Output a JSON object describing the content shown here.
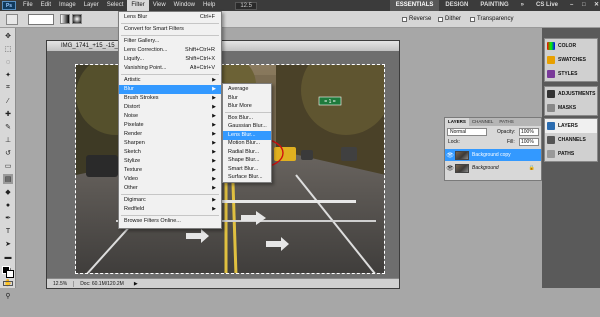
{
  "appbar": {
    "logo": "Ps",
    "menus": [
      "File",
      "Edit",
      "Image",
      "Layer",
      "Select",
      "Filter",
      "View",
      "Window",
      "Help"
    ],
    "active_menu": "Filter",
    "zoom": "12.5",
    "workspaces": [
      "ESSENTIALS",
      "DESIGN",
      "PAINTING"
    ],
    "more": "»",
    "cslive": "CS Live",
    "window_buttons": [
      "–",
      "□",
      "✕"
    ]
  },
  "options": {
    "reverse": "Reverse",
    "dither": "Dither",
    "transparency": "Transparency"
  },
  "document": {
    "title": "IMG_1741_+15_-15_Ima",
    "zoom": "12.5%",
    "doc_size": "Doc: 60.1M/120.2M"
  },
  "filter_menu": {
    "items": [
      {
        "label": "Lens Blur",
        "shortcut": "Ctrl+F"
      },
      {
        "label": "Convert for Smart Filters"
      },
      {
        "label": "Filter Gallery..."
      },
      {
        "label": "Lens Correction...",
        "shortcut": "Shift+Ctrl+R"
      },
      {
        "label": "Liquify...",
        "shortcut": "Shift+Ctrl+X"
      },
      {
        "label": "Vanishing Point...",
        "shortcut": "Alt+Ctrl+V"
      },
      {
        "label": "Artistic",
        "sub": true
      },
      {
        "label": "Blur",
        "sub": true,
        "highlight": true
      },
      {
        "label": "Brush Strokes",
        "sub": true
      },
      {
        "label": "Distort",
        "sub": true
      },
      {
        "label": "Noise",
        "sub": true
      },
      {
        "label": "Pixelate",
        "sub": true
      },
      {
        "label": "Render",
        "sub": true
      },
      {
        "label": "Sharpen",
        "sub": true
      },
      {
        "label": "Sketch",
        "sub": true
      },
      {
        "label": "Stylize",
        "sub": true
      },
      {
        "label": "Texture",
        "sub": true
      },
      {
        "label": "Video",
        "sub": true
      },
      {
        "label": "Other",
        "sub": true
      },
      {
        "label": "Digimarc",
        "sub": true
      },
      {
        "label": "Redfield",
        "sub": true
      },
      {
        "label": "Browse Filters Online..."
      }
    ]
  },
  "blur_menu": {
    "items": [
      "Average",
      "Blur",
      "Blur More",
      "Box Blur...",
      "Gaussian Blur...",
      "Lens Blur...",
      "Motion Blur...",
      "Radial Blur...",
      "Shape Blur...",
      "Smart Blur...",
      "Surface Blur..."
    ],
    "highlighted": "Lens Blur..."
  },
  "dock": {
    "group1": [
      "COLOR",
      "SWATCHES",
      "STYLES"
    ],
    "group2": [
      "ADJUSTMENTS",
      "MASKS"
    ],
    "group3": [
      "LAYERS",
      "CHANNELS",
      "PATHS"
    ]
  },
  "layers_panel": {
    "tabs": [
      "LAYERS",
      "CHANNEL",
      "PATHS"
    ],
    "blend_mode": "Normal",
    "opacity_label": "Opacity:",
    "opacity": "100%",
    "lock_label": "Lock:",
    "fill_label": "Fill:",
    "fill": "100%",
    "layers": [
      {
        "name": "Background copy",
        "selected": true
      },
      {
        "name": "Background",
        "selected": false
      }
    ]
  },
  "photo": {
    "sign_text": "= 1 =",
    "sign_color": "#1e7a3c",
    "accent_red": "#d01010"
  },
  "colors": {
    "highlight": "#3399ff"
  }
}
